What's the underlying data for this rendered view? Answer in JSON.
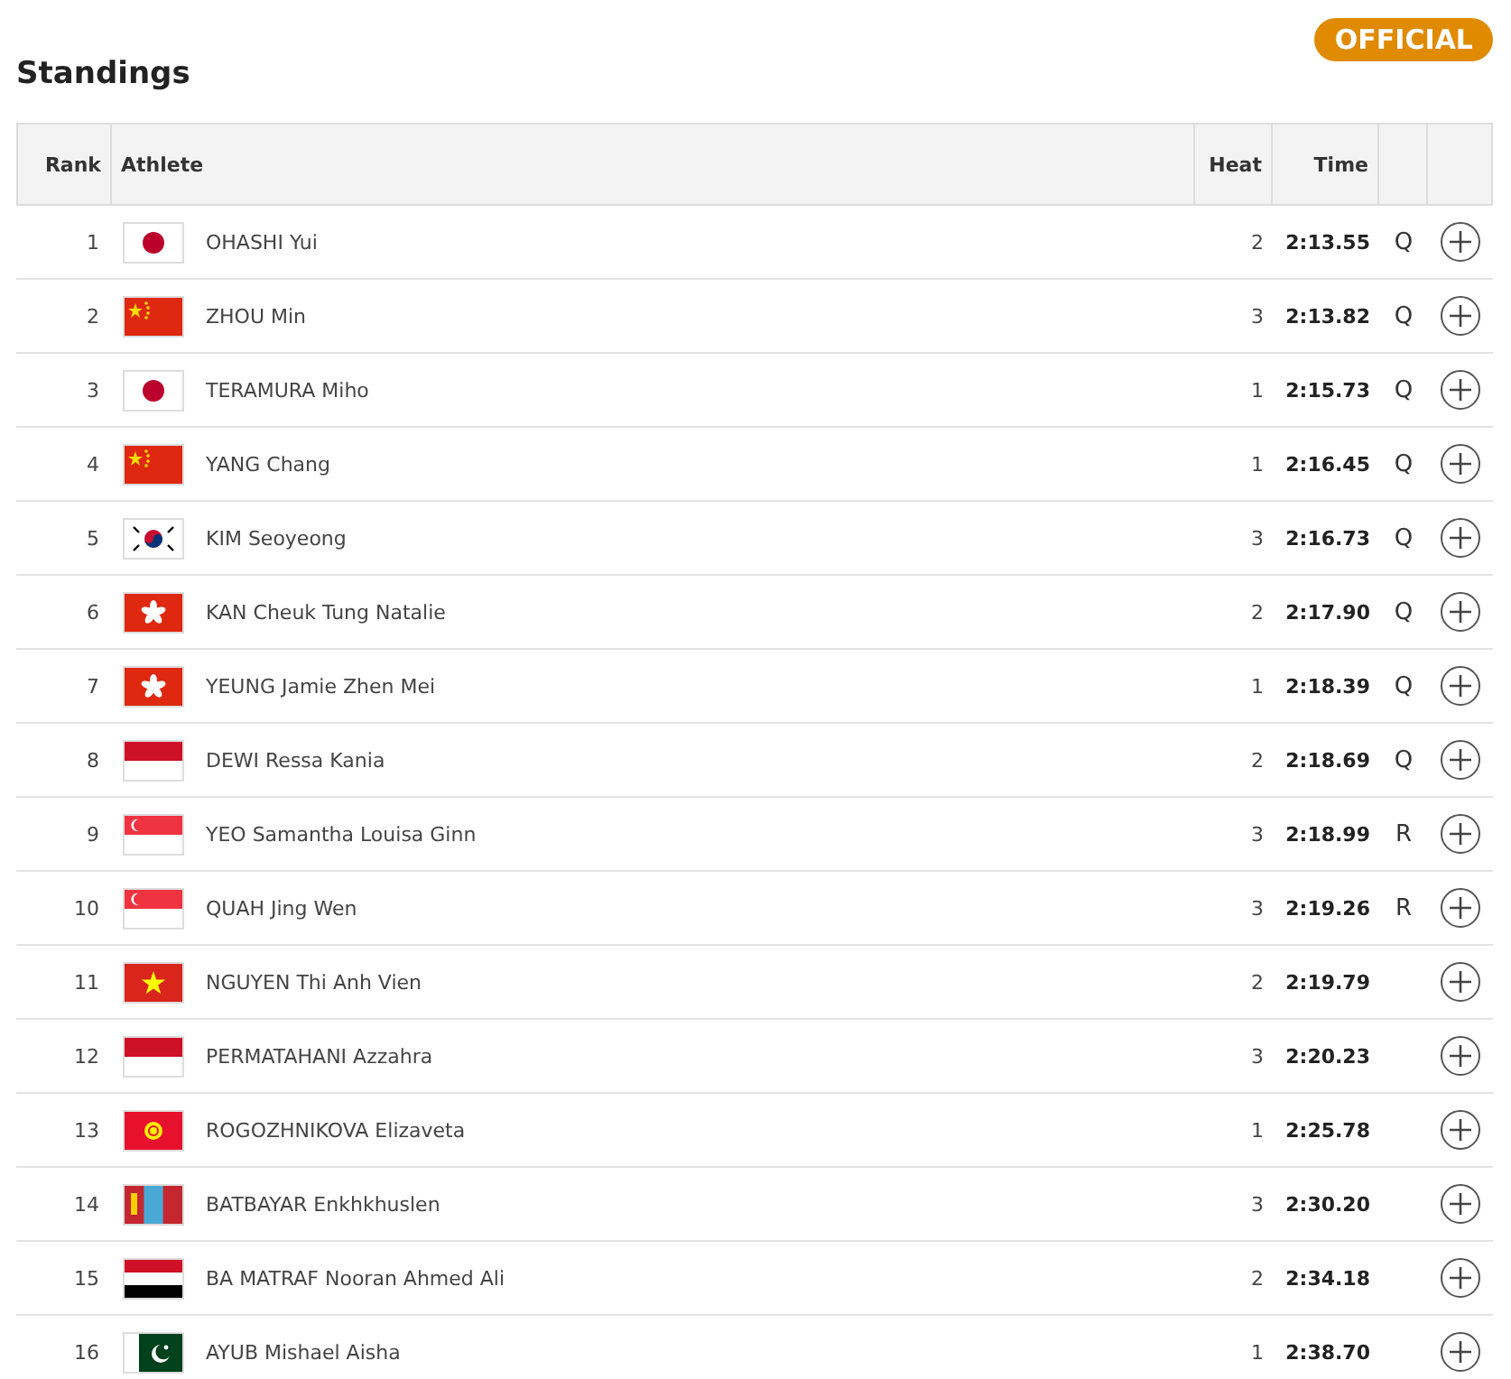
{
  "title": "Standings",
  "status_badge": "OFFICIAL",
  "table": {
    "columns": [
      "Rank",
      "Athlete",
      "Heat",
      "Time"
    ],
    "rows": [
      {
        "rank": "1",
        "kind": "japan",
        "athlete": "OHASHI Yui",
        "heat": "2",
        "time": "2:13.55",
        "qualifier": "Q"
      },
      {
        "rank": "2",
        "kind": "china",
        "athlete": "ZHOU Min",
        "heat": "3",
        "time": "2:13.82",
        "qualifier": "Q"
      },
      {
        "rank": "3",
        "kind": "japan",
        "athlete": "TERAMURA Miho",
        "heat": "1",
        "time": "2:15.73",
        "qualifier": "Q"
      },
      {
        "rank": "4",
        "kind": "china",
        "athlete": "YANG Chang",
        "heat": "1",
        "time": "2:16.45",
        "qualifier": "Q"
      },
      {
        "rank": "5",
        "kind": "korea",
        "athlete": "KIM Seoyeong",
        "heat": "3",
        "time": "2:16.73",
        "qualifier": "Q"
      },
      {
        "rank": "6",
        "kind": "hongkong",
        "athlete": "KAN Cheuk Tung Natalie",
        "heat": "2",
        "time": "2:17.90",
        "qualifier": "Q"
      },
      {
        "rank": "7",
        "kind": "hongkong",
        "athlete": "YEUNG Jamie Zhen Mei",
        "heat": "1",
        "time": "2:18.39",
        "qualifier": "Q"
      },
      {
        "rank": "8",
        "kind": "indonesia",
        "athlete": "DEWI Ressa Kania",
        "heat": "2",
        "time": "2:18.69",
        "qualifier": "Q"
      },
      {
        "rank": "9",
        "kind": "singapore",
        "athlete": "YEO Samantha Louisa Ginn",
        "heat": "3",
        "time": "2:18.99",
        "qualifier": "R"
      },
      {
        "rank": "10",
        "kind": "singapore",
        "athlete": "QUAH Jing Wen",
        "heat": "3",
        "time": "2:19.26",
        "qualifier": "R"
      },
      {
        "rank": "11",
        "kind": "vietnam",
        "athlete": "NGUYEN Thi Anh Vien",
        "heat": "2",
        "time": "2:19.79"
      },
      {
        "rank": "12",
        "kind": "indonesia",
        "athlete": "PERMATAHANI Azzahra",
        "heat": "3",
        "time": "2:20.23"
      },
      {
        "rank": "13",
        "kind": "kyrgyzstan",
        "athlete": "ROGOZHNIKOVA Elizaveta",
        "heat": "1",
        "time": "2:25.78"
      },
      {
        "rank": "14",
        "kind": "mongolia",
        "athlete": "BATBAYAR Enkhkhuslen",
        "heat": "3",
        "time": "2:30.20"
      },
      {
        "rank": "15",
        "kind": "yemen",
        "athlete": "BA MATRAF Nooran Ahmed Ali",
        "heat": "2",
        "time": "2:34.18"
      },
      {
        "rank": "16",
        "kind": "pakistan",
        "athlete": "AYUB Mishael Aisha",
        "heat": "1",
        "time": "2:38.70"
      }
    ]
  }
}
